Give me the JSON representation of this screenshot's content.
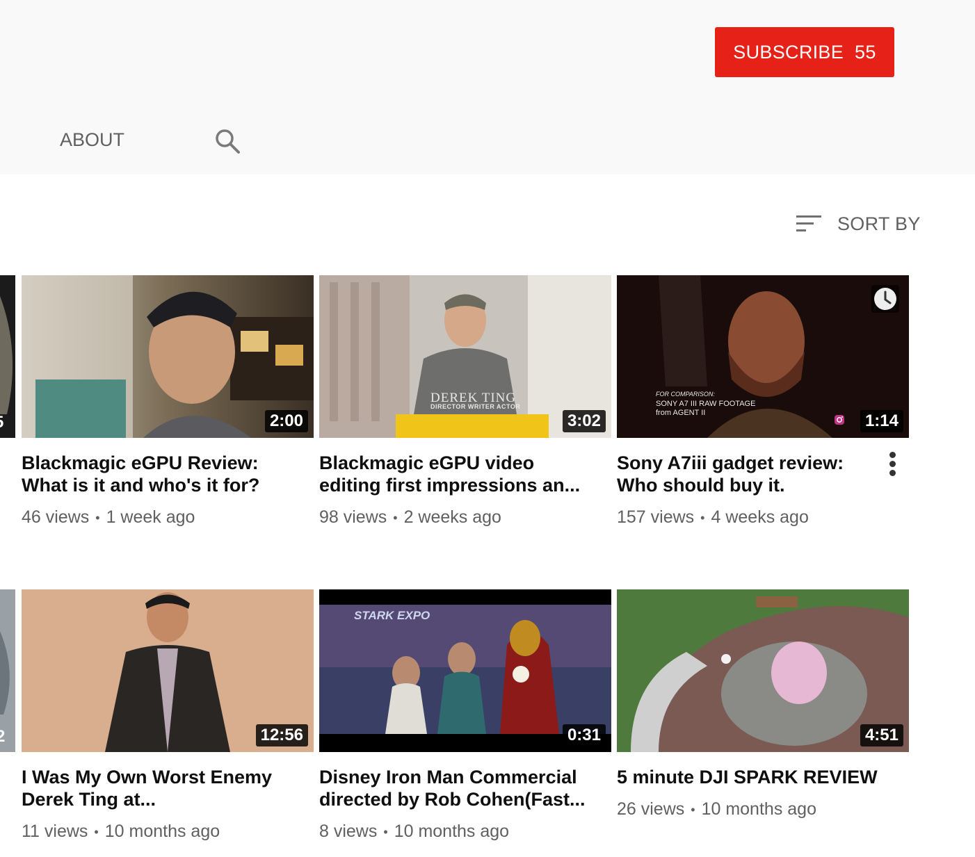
{
  "header": {
    "subscribe_label": "SUBSCRIBE",
    "subscriber_count": "55",
    "tab_about": "ABOUT"
  },
  "toolbar": {
    "sort_label": "SORT BY"
  },
  "colors": {
    "subscribe_bg": "#e62117",
    "meta_text": "#606060"
  },
  "edge_cards": [
    {
      "duration_fragment": "5"
    },
    {
      "duration_fragment": "2"
    }
  ],
  "videos": [
    {
      "title": "Blackmagic eGPU Review: What is it and who's it for?",
      "views": "46 views",
      "age": "1 week ago",
      "duration": "2:00"
    },
    {
      "title": "Blackmagic eGPU video editing first impressions an...",
      "views": "98 views",
      "age": "2 weeks ago",
      "duration": "3:02",
      "thumb_text_main": "DEREK TING",
      "thumb_text_sub": "DIRECTOR WRITER ACTOR"
    },
    {
      "title": "Sony A7iii gadget review: Who should buy it.",
      "views": "157 views",
      "age": "4 weeks ago",
      "duration": "1:14",
      "thumb_text_1": "FOR COMPARISON:",
      "thumb_text_2": "SONY A7 III RAW FOOTAGE",
      "thumb_text_3": "from AGENT II"
    },
    {
      "title": "I Was My Own Worst Enemy Derek Ting at...",
      "views": "11 views",
      "age": "10 months ago",
      "duration": "12:56"
    },
    {
      "title": "Disney Iron Man Commercial directed by Rob Cohen(Fast...",
      "views": "8 views",
      "age": "10 months ago",
      "duration": "0:31",
      "thumb_text": "STARK EXPO"
    },
    {
      "title": "5 minute DJI SPARK REVIEW",
      "views": "26 views",
      "age": "10 months ago",
      "duration": "4:51"
    }
  ],
  "icons": [
    "search-icon",
    "sort-icon",
    "clock-icon",
    "instagram-icon",
    "more-vert-icon"
  ]
}
